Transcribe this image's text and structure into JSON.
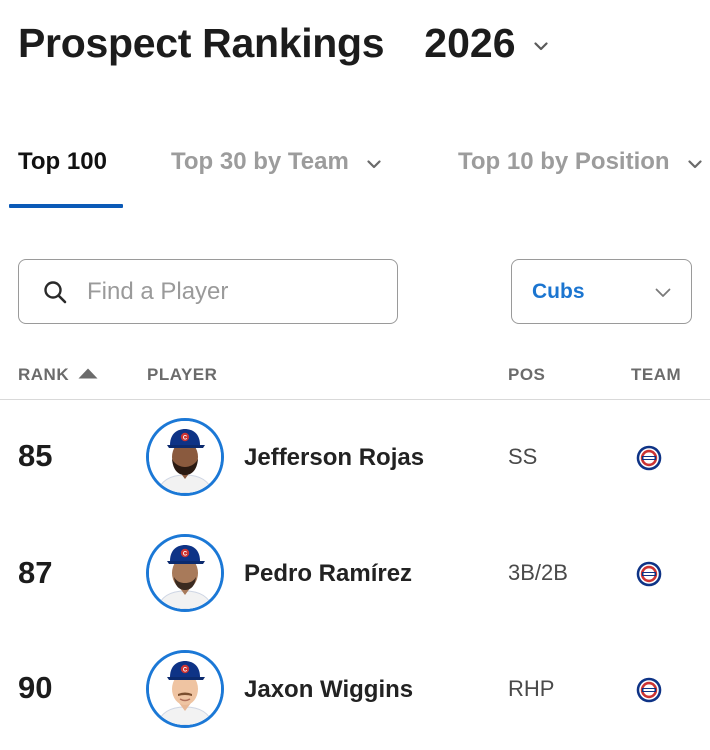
{
  "header": {
    "title": "Prospect Rankings",
    "year": "2026"
  },
  "tabs": [
    {
      "label": "Top 100",
      "active": true
    },
    {
      "label": "Top 30 by Team",
      "active": false
    },
    {
      "label": "Top 10 by Position",
      "active": false
    }
  ],
  "search": {
    "placeholder": "Find a Player",
    "value": ""
  },
  "team_filter": {
    "value": "Cubs"
  },
  "table": {
    "columns": {
      "rank": "RANK",
      "player": "PLAYER",
      "pos": "POS",
      "team": "TEAM"
    },
    "sort": {
      "column": "rank",
      "direction": "ascending"
    },
    "rows": [
      {
        "rank": "85",
        "player": "Jefferson Rojas",
        "pos": "SS",
        "team_icon": "cubs-logo-icon"
      },
      {
        "rank": "87",
        "player": "Pedro Ramírez",
        "pos": "3B/2B",
        "team_icon": "cubs-logo-icon"
      },
      {
        "rank": "90",
        "player": "Jaxon Wiggins",
        "pos": "RHP",
        "team_icon": "cubs-logo-icon"
      }
    ]
  },
  "colors": {
    "accent_blue": "#0b5ab7",
    "link_blue": "#1b75d0",
    "avatar_ring": "#1b78d6",
    "cubs_blue": "#0e3386",
    "cubs_red": "#cc3433"
  }
}
